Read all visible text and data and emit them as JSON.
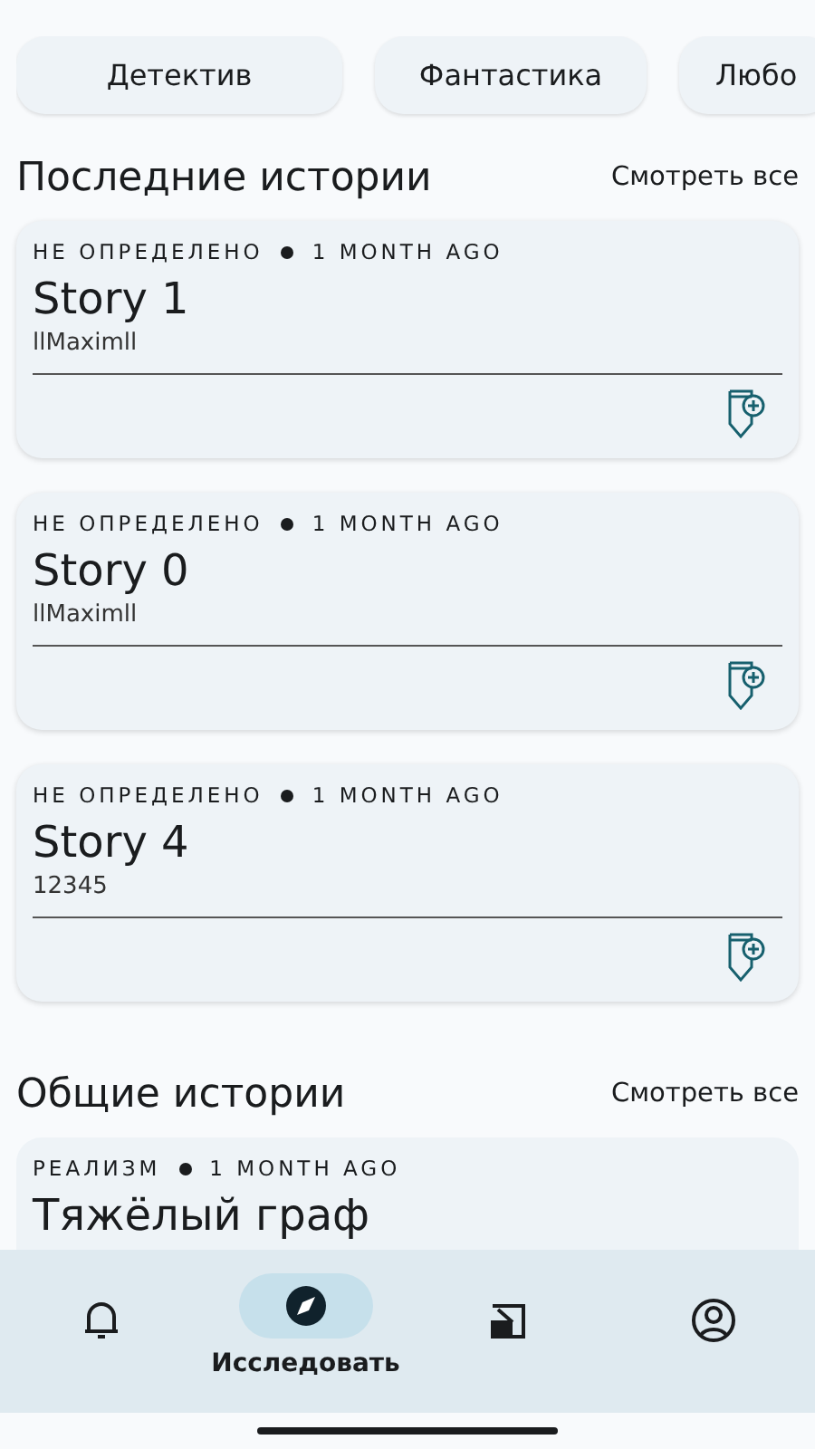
{
  "genres": [
    {
      "label": "Детектив"
    },
    {
      "label": "Фантастика"
    },
    {
      "label": "Любо"
    }
  ],
  "sections": [
    {
      "title": "Последние истории",
      "link": "Смотреть все",
      "stories": [
        {
          "genre": "НЕ ОПРЕДЕЛЕНО",
          "time": "1 MONTH AGO",
          "title": "Story 1",
          "author": "llMaximll"
        },
        {
          "genre": "НЕ ОПРЕДЕЛЕНО",
          "time": "1 MONTH AGO",
          "title": "Story 0",
          "author": "llMaximll"
        },
        {
          "genre": "НЕ ОПРЕДЕЛЕНО",
          "time": "1 MONTH AGO",
          "title": "Story 4",
          "author": "12345"
        }
      ]
    },
    {
      "title": "Общие истории",
      "link": "Смотреть все",
      "stories": [
        {
          "genre": "РЕАЛИЗМ",
          "time": "1 MONTH AGO",
          "title": "Тяжёлый граф"
        }
      ]
    }
  ],
  "nav": [
    {
      "kind": "bell",
      "selected": false
    },
    {
      "kind": "compass",
      "label": "Исследовать",
      "selected": true
    },
    {
      "kind": "book",
      "selected": false
    },
    {
      "kind": "profile",
      "selected": false
    }
  ]
}
